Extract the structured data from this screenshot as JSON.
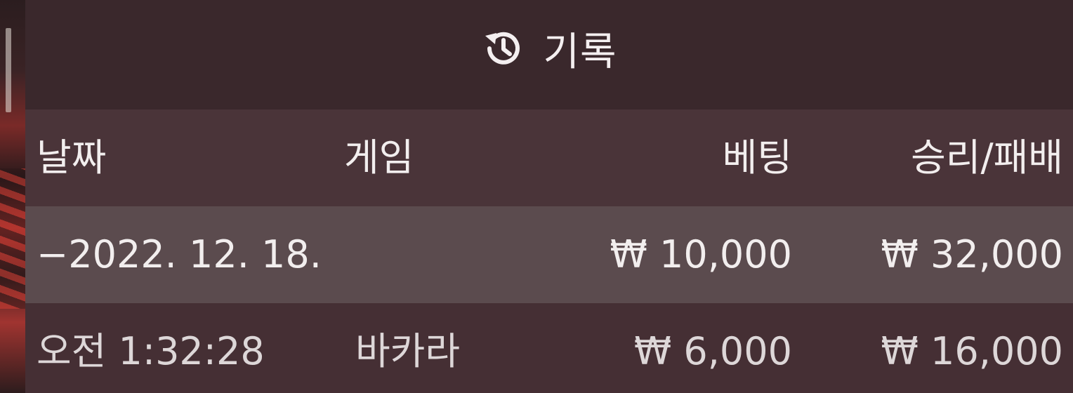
{
  "header": {
    "icon": "history-icon",
    "title": "기록"
  },
  "table": {
    "columns": {
      "date": "날짜",
      "game": "게임",
      "bet": "베팅",
      "result": "승리/패배"
    },
    "groups": [
      {
        "date_label": "−2022. 12. 18.",
        "bet_total": "₩ 10,000",
        "result_total": "₩ 32,000",
        "rows": [
          {
            "time": "오전 1:32:28",
            "game": "바카라",
            "bet": "₩ 6,000",
            "result": "₩ 16,000"
          }
        ]
      }
    ]
  },
  "colors": {
    "panel": "#3e2b30",
    "header_row": "#4a3439",
    "group_row": "#5b4b4e",
    "text": "#f2eeee"
  }
}
